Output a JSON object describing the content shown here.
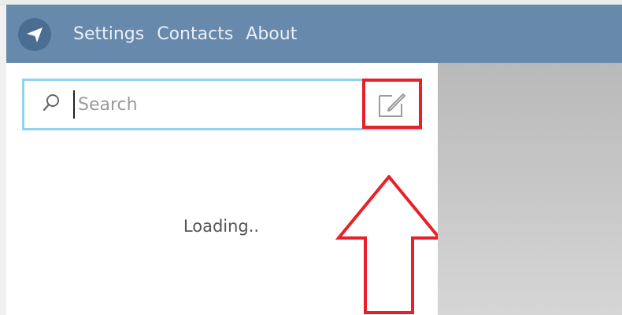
{
  "header": {
    "logo_icon": "paper-plane-icon",
    "nav": [
      {
        "label": "Settings"
      },
      {
        "label": "Contacts"
      },
      {
        "label": "About"
      }
    ]
  },
  "search": {
    "placeholder": "Search",
    "value": "",
    "icon": "search-icon"
  },
  "compose": {
    "icon": "compose-icon"
  },
  "sidebar": {
    "status_text": "Loading.."
  },
  "annotation": {
    "highlight_color": "#e8202a",
    "arrow_color": "#e8202a"
  },
  "colors": {
    "header_bg": "#6789ab",
    "search_border": "#8fd3f4"
  }
}
